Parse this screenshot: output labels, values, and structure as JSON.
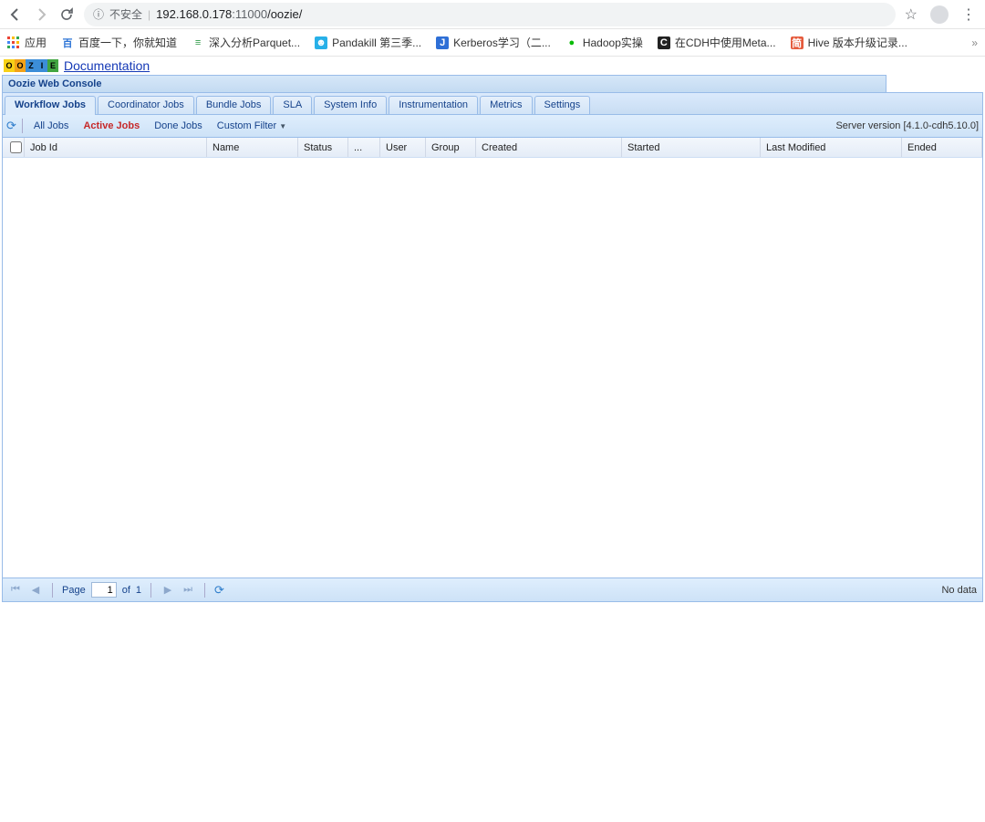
{
  "browser": {
    "insecure_label": "不安全",
    "url_ip": "192.168.0.178",
    "url_port": ":11000",
    "url_path": "/oozie/"
  },
  "bookmarks": {
    "apps_label": "应用",
    "items": [
      {
        "label": "百度一下，你就知道",
        "favicon": "百",
        "color": "#2b73d6",
        "bg": ""
      },
      {
        "label": "深入分析Parquet...",
        "favicon": "≡",
        "color": "#2e9a47",
        "bg": ""
      },
      {
        "label": "Pandakill 第三季...",
        "favicon": "☻",
        "color": "#fff",
        "bg": "#27b0e8"
      },
      {
        "label": "Kerberos学习（二...",
        "favicon": "J",
        "color": "#fff",
        "bg": "#2e6fd6"
      },
      {
        "label": "Hadoop实操",
        "favicon": "●",
        "color": "#09bb07",
        "bg": ""
      },
      {
        "label": "在CDH中使用Meta...",
        "favicon": "C",
        "color": "#fff",
        "bg": "#222"
      },
      {
        "label": "Hive 版本升级记录...",
        "favicon": "简",
        "color": "#fff",
        "bg": "#e55b3d"
      }
    ]
  },
  "page": {
    "doc_link": "Documentation",
    "console_title": "Oozie Web Console",
    "tabs": [
      "Workflow Jobs",
      "Coordinator Jobs",
      "Bundle Jobs",
      "SLA",
      "System Info",
      "Instrumentation",
      "Metrics",
      "Settings"
    ],
    "active_tab": 0,
    "filters": {
      "all": "All Jobs",
      "active": "Active Jobs",
      "done": "Done Jobs",
      "custom": "Custom Filter"
    },
    "server_version_label": "Server version",
    "server_version": "[4.1.0-cdh5.10.0]",
    "columns": [
      "Job Id",
      "Name",
      "Status",
      "...",
      "User",
      "Group",
      "Created",
      "Started",
      "Last Modified",
      "Ended"
    ],
    "paging": {
      "page_label": "Page",
      "of_label": "of",
      "current": "1",
      "total": "1",
      "status": "No data"
    }
  }
}
